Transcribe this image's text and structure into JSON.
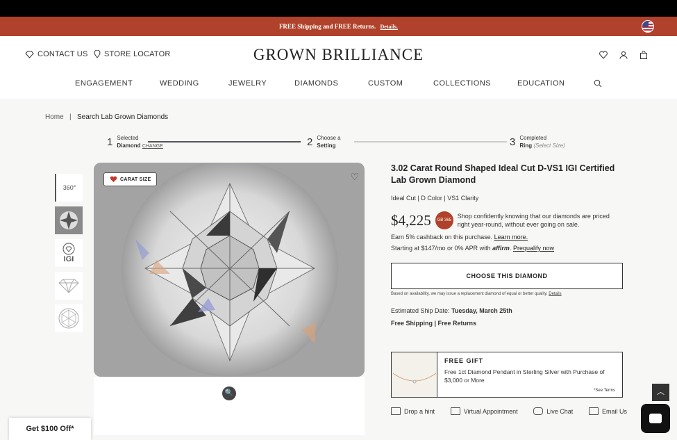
{
  "promo": {
    "text": "FREE Shipping and FREE Returns.",
    "details": "Details."
  },
  "header": {
    "contact": "CONTACT US",
    "store": "STORE LOCATOR",
    "logo": "GROWN BRILLIANCE"
  },
  "nav": {
    "items": [
      "ENGAGEMENT",
      "WEDDING",
      "JEWELRY",
      "DIAMONDS",
      "CUSTOM",
      "COLLECTIONS",
      "EDUCATION"
    ]
  },
  "breadcrumb": {
    "home": "Home",
    "sep": "|",
    "current": "Search Lab Grown Diamonds"
  },
  "steps": [
    {
      "num": "1",
      "line1": "Selected",
      "line2": "Diamond",
      "extra": "CHANGE"
    },
    {
      "num": "2",
      "line1": "Choose a",
      "line2": "Setting",
      "extra": ""
    },
    {
      "num": "3",
      "line1": "Completed",
      "line2": "Ring",
      "extra": "(Select Size)"
    }
  ],
  "thumbs": {
    "t1": "360°",
    "t3": "IGI"
  },
  "image": {
    "carat_badge": "CARAT SIZE"
  },
  "product": {
    "title": "3.02 Carat Round Shaped Ideal Cut D-VS1 IGI Certified Lab Grown Diamond",
    "specs": "Ideal Cut | D Color | VS1 Clarity",
    "price": "$4,225",
    "seal": "GB 365",
    "price_msg": "Shop confidently knowing that our diamonds are priced right year-round, without ever going on sale.",
    "cashback": "Earn 5% cashback on this purchase.",
    "learn_more": "Learn more.",
    "finance": "Starting at $147/mo or 0% APR with",
    "affirm": "affirm",
    "prequalify": "Prequalify now",
    "choose_btn": "CHOOSE THIS DIAMOND",
    "fine_print": "Based on availability, we may issue a replacement diamond of equal or better quality.",
    "fine_details": "Details",
    "ship_label": "Estimated Ship Date:",
    "ship_date": "Tuesday, March 25th",
    "ship_free": "Free Shipping | Free Returns"
  },
  "gift": {
    "title": "FREE GIFT",
    "text": "Free 1ct Diamond Pendant in Sterling Silver with Purchase of $3,000 or More",
    "terms": "*See Terms"
  },
  "actions": [
    "Drop a hint",
    "Virtual Appointment",
    "Live Chat",
    "Email Us"
  ],
  "promo_tab": "Get $100 Off*",
  "colors": {
    "brand": "#b0412a",
    "dark": "#111111"
  }
}
